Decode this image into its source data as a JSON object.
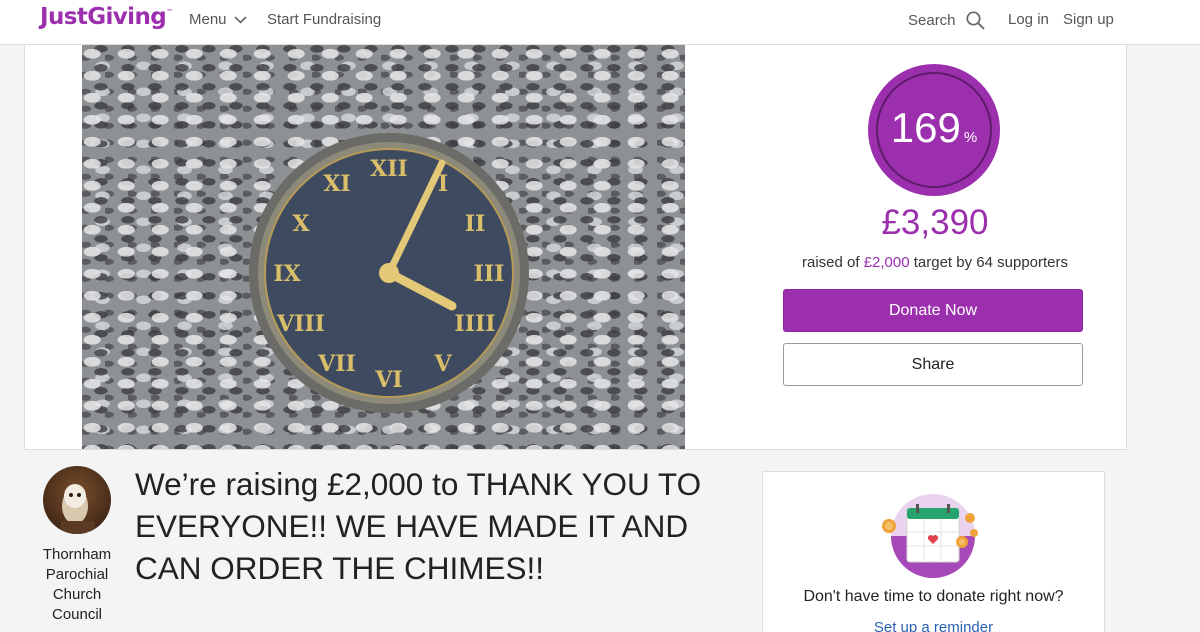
{
  "header": {
    "logo_text": "JustGiving",
    "logo_tm": "™",
    "menu_label": "Menu",
    "start_fundraising_label": "Start Fundraising",
    "search_label": "Search",
    "login_label": "Log in",
    "signup_label": "Sign up"
  },
  "progress": {
    "percent": "169",
    "percent_sign": "%",
    "amount_raised": "£3,390",
    "raised_prefix": "raised of ",
    "target": "£2,000",
    "target_by": " target by ",
    "supporters": "64 supporters"
  },
  "actions": {
    "donate_label": "Donate Now",
    "share_label": "Share"
  },
  "organiser": {
    "name": "Thornham Parochial Church Council"
  },
  "page": {
    "headline": "We’re raising £2,000 to THANK YOU TO EVERYONE!! WE HAVE MADE IT AND CAN ORDER THE CHIMES!!"
  },
  "reminder": {
    "text": "Don't have time to donate right now?",
    "link_label": "Set up a reminder"
  },
  "icons": {
    "menu": "chevron-down-icon",
    "search": "search-icon",
    "avatar": "owl-avatar",
    "calendar": "calendar-heart-icon"
  },
  "colors": {
    "brand": "#9b2fae",
    "link": "#2a5fb0"
  }
}
